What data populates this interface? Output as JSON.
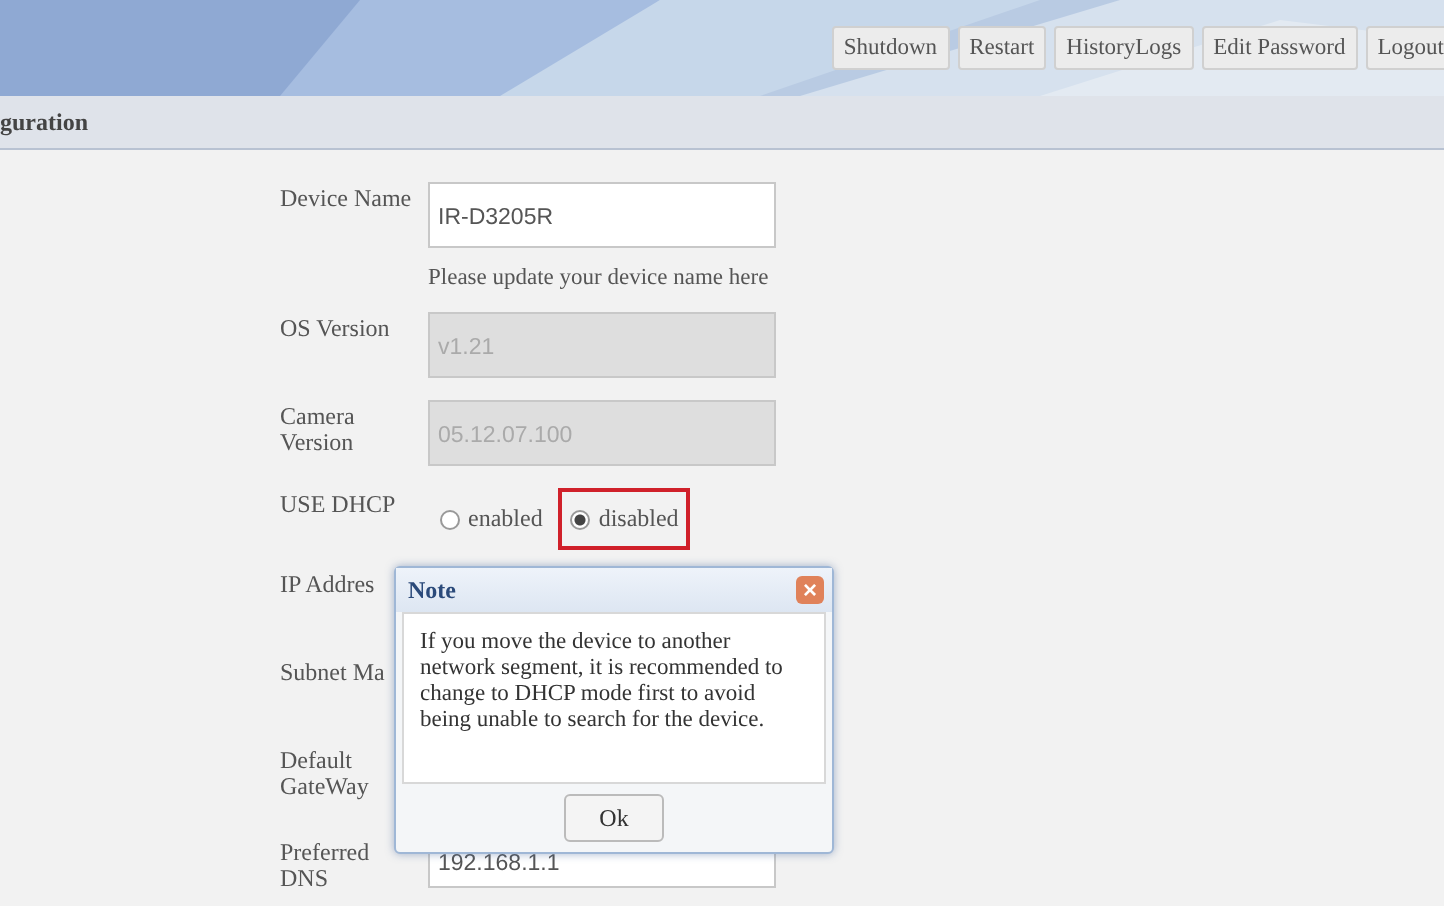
{
  "header": {
    "buttons": [
      "Shutdown",
      "Restart",
      "HistoryLogs",
      "Edit Password",
      "Logout"
    ]
  },
  "section": {
    "title": "guration"
  },
  "form": {
    "fields": [
      {
        "kind": "input",
        "label": "Device Name",
        "value": "IR-D3205R",
        "disabled": false,
        "hint": "Please update your device name here"
      },
      {
        "kind": "input",
        "label": "OS Version",
        "value": "v1.21",
        "disabled": true
      },
      {
        "kind": "input",
        "label": "Camera Version",
        "value": "05.12.07.100",
        "disabled": true
      },
      {
        "kind": "radio",
        "label": "USE DHCP",
        "options": [
          {
            "label": "enabled",
            "selected": false
          },
          {
            "label": "disabled",
            "selected": true
          }
        ]
      },
      {
        "kind": "covered",
        "label": "IP Addres"
      },
      {
        "kind": "covered",
        "label": "Subnet Ma"
      },
      {
        "kind": "covered",
        "label": "Default GateWay"
      },
      {
        "kind": "input",
        "label": "Preferred DNS",
        "value": "192.168.1.1",
        "disabled": false
      }
    ]
  },
  "dialog": {
    "title": "Note",
    "message": "If you move the device to another network segment, it is recommended to change to DHCP mode first to avoid being unable to search for the device.",
    "close": "×",
    "button": "Ok"
  }
}
